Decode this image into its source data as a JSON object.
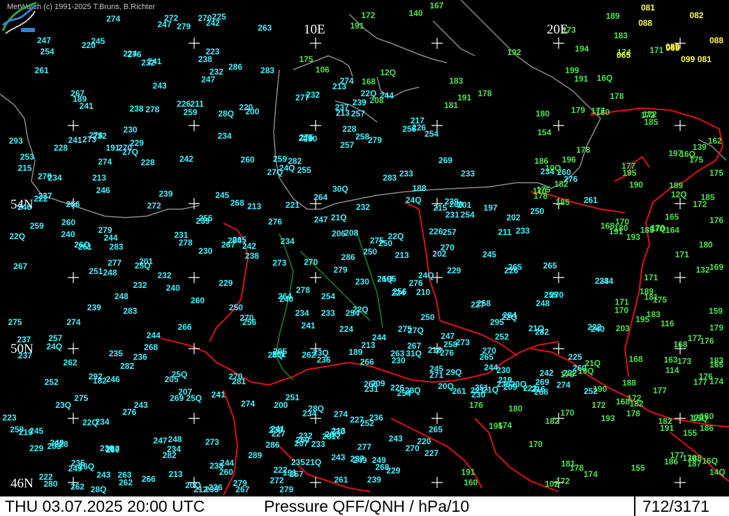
{
  "header": {
    "credit": "MetWatch  (c) 1991-2025 T.Bruns, B.Richter"
  },
  "grid_labels": {
    "lon_10e": "10E",
    "lon_20e": "20E",
    "lat_54n": "54N",
    "lat_50n": "50N",
    "lat_46n": "46N"
  },
  "footer": {
    "datetime": "THU 03.07.2025 20:00 UTC",
    "parameter": "Pressure QFF/QNH / hPa/10",
    "station_count": "712/3171"
  },
  "colors": {
    "background": "#000000",
    "cyan_values": "#3ff2ff",
    "green_values": "#4be34b",
    "yellow_values": "#ffff40",
    "borders": "#e01010",
    "coast": "#808080",
    "rivers": "#1a8a1a"
  },
  "stations_cyan": [
    "220",
    "215",
    "204",
    "182",
    "234",
    "221",
    "206",
    "189",
    "191",
    "197",
    "20Q",
    "189",
    "191",
    "201",
    "207",
    "203",
    "213",
    "202",
    "209",
    "220",
    "211",
    "219",
    "224",
    "228",
    "231",
    "23Q",
    "236",
    "188",
    "195",
    "227",
    "233",
    "254",
    "242",
    "241",
    "260",
    "25Q",
    "250",
    "262",
    "258",
    "264",
    "267",
    "265",
    "265",
    "269",
    "267",
    "259",
    "275",
    "276",
    "273",
    "274",
    "270",
    "26Q",
    "250",
    "260",
    "261",
    "272",
    "276",
    "277",
    "274",
    "263",
    "264",
    "26Q",
    "262",
    "272",
    "269",
    "273",
    "283",
    "274",
    "283",
    "282",
    "280",
    "279",
    "276",
    "274",
    "270",
    "265",
    "274",
    "278",
    "272",
    "279",
    "281",
    "282",
    "283",
    "286",
    "28Q",
    "286",
    "284",
    "282",
    "279",
    "276",
    "274",
    "270",
    "289",
    "282",
    "278",
    "28Q",
    "277",
    "276",
    "270",
    "286",
    "293",
    "283",
    "292",
    "28Q",
    "27Q",
    "279",
    "27Q",
    "26Q",
    "295",
    "29Q",
    "28Q",
    "27Q",
    "26Q",
    "25Q",
    "249",
    "24Q",
    "233",
    "230",
    "227",
    "229",
    "222",
    "220",
    "241",
    "229",
    "25Q",
    "26Q",
    "24Q",
    "24Q",
    "23Q",
    "237",
    "231",
    "222",
    "232",
    "228",
    "22Q",
    "22Q",
    "20Q",
    "30Q",
    "21Q",
    "31Q",
    "232",
    "215",
    "21Q",
    "232",
    "230",
    "244",
    "235",
    "235",
    "239",
    "230",
    "224",
    "227",
    "22Q",
    "21Q",
    "247",
    "246",
    "250",
    "245",
    "235",
    "233",
    "22Q",
    "218",
    "252",
    "250",
    "251",
    "247",
    "239",
    "242",
    "237",
    "229",
    "257",
    "254",
    "251",
    "241",
    "260",
    "258",
    "254",
    "256",
    "248",
    "241",
    "243",
    "237",
    "22Q",
    "266",
    "261",
    "257",
    "252",
    "247",
    "237",
    "267",
    "266",
    "260",
    "254",
    "250",
    "245",
    "243",
    "233",
    "230",
    "270",
    "268",
    "267",
    "262",
    "260",
    "256",
    "254",
    "251",
    "249",
    "245",
    "276",
    "274",
    "270",
    "270",
    "268",
    "262",
    "255",
    "250",
    "275",
    "279",
    "270",
    "268",
    "263",
    "260",
    "256",
    "252",
    "247",
    "275",
    "273",
    "271",
    "268",
    "261",
    "260",
    "259",
    "253",
    "248",
    "243",
    "279",
    "277",
    "275",
    "263",
    "261",
    "258",
    "252",
    "245",
    "239",
    "278",
    "275",
    "266",
    "257",
    "256",
    "254",
    "249",
    "244",
    "240",
    "276",
    "273",
    "261",
    "257",
    "249",
    "250",
    "247",
    "244",
    "239",
    "270",
    "265",
    "261",
    "255",
    "251",
    "244",
    "244",
    "240",
    "276",
    "266",
    "257",
    "255",
    "244",
    "243",
    "245",
    "239",
    "269",
    "267",
    "259",
    "250",
    "241",
    "243",
    "248",
    "247",
    "242",
    "246",
    "260",
    "246",
    "248",
    "244",
    "240",
    "236",
    "235",
    "239",
    "235",
    "241",
    "242",
    "240",
    "237",
    "237",
    "232",
    "234",
    "236",
    "239",
    "233",
    "232",
    "225",
    "232",
    "232",
    "234",
    "228",
    "228",
    "224",
    "226",
    "222",
    "227",
    "216",
    "226",
    "222",
    "238",
    "236",
    "238",
    "232",
    "234",
    "231",
    "229",
    "234",
    "225",
    "223",
    "229",
    "230",
    "205",
    "222",
    "226",
    "213",
    "213",
    "213",
    "202",
    "209",
    "211",
    "213",
    "205",
    "219",
    "212",
    "213",
    "210",
    "205",
    "21Q",
    "233",
    "230",
    "238",
    "234",
    "232",
    "24Q",
    "236",
    "22Q",
    "226",
    "234",
    "230",
    "226",
    "221",
    "238",
    "234",
    "240",
    "223",
    "213",
    "217",
    "208",
    "200",
    "207",
    "201",
    "20Q",
    "200",
    "213"
  ],
  "stations_green": [
    "178",
    "162",
    "159",
    "168",
    "160",
    "140",
    "139",
    "170",
    "176",
    "174",
    "171",
    "154",
    "132",
    "193",
    "191",
    "191",
    "185",
    "180",
    "168",
    "155",
    "106",
    "10Q",
    "116",
    "114",
    "102",
    "191",
    "172",
    "164",
    "163",
    "14Q",
    "12Q",
    "12Q",
    "203",
    "188",
    "188",
    "180",
    "197",
    "185",
    "15Q",
    "170",
    "16Q",
    "16Q",
    "17Q",
    "19Q",
    "16Q",
    "191",
    "185",
    "165",
    "21Q",
    "191",
    "208",
    "195",
    "176",
    "165",
    "155",
    "199",
    "177",
    "168",
    "182",
    "172",
    "167",
    "189",
    "179",
    "182",
    "180",
    "172",
    "170",
    "171",
    "173",
    "195",
    "183",
    "175",
    "171",
    "177",
    "178",
    "194",
    "179",
    "169",
    "177",
    "187",
    "180",
    "175",
    "176",
    "176",
    "172",
    "174",
    "186",
    "181",
    "177",
    "182",
    "192",
    "178",
    "191",
    "183",
    "181",
    "175",
    "175",
    "171",
    "174",
    "176",
    "183",
    "190",
    "189",
    "180",
    "186",
    "178",
    "177",
    "175",
    "172",
    "174",
    "173",
    "172",
    "170",
    "168",
    "170",
    "168",
    "178",
    "180",
    "178",
    "177",
    "172",
    "185",
    "183",
    "178",
    "186",
    "181",
    "182",
    "195",
    "178",
    "170",
    "189",
    "196",
    "193",
    "190"
  ],
  "stations_yellow": [
    "088",
    "081",
    "069",
    "065",
    "089",
    "088",
    "081",
    "082",
    "099"
  ]
}
